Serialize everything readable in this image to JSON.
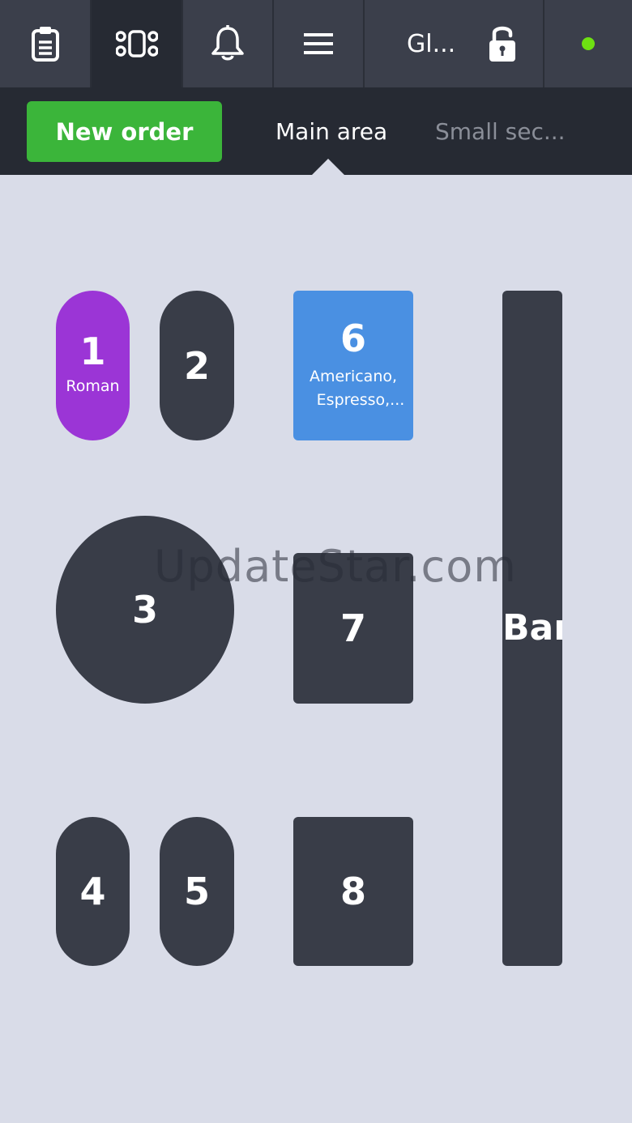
{
  "toolbar": {
    "items": [
      {
        "name": "orders",
        "icon": "clipboard-icon"
      },
      {
        "name": "tables",
        "icon": "table-layout-icon",
        "active": true
      },
      {
        "name": "notifications",
        "icon": "bell-icon"
      },
      {
        "name": "menu",
        "icon": "hamburger-icon"
      }
    ],
    "user_name": "Gl...",
    "lock_icon": "unlocked-padlock-icon",
    "status_color": "#6ee012"
  },
  "secondary_bar": {
    "new_order_label": "New order",
    "tabs": [
      {
        "label": "Main area",
        "active": true
      },
      {
        "label": "Small sec...",
        "active": false
      }
    ]
  },
  "tables": [
    {
      "number": "1",
      "subtitle": "Roman",
      "color": "#9b35d6"
    },
    {
      "number": "2"
    },
    {
      "number": "6",
      "subtitle_lines": [
        "Americano,",
        "Espresso,..."
      ],
      "color": "#4a90e2"
    },
    {
      "number": "3"
    },
    {
      "number": "7"
    },
    {
      "number": "4"
    },
    {
      "number": "5"
    },
    {
      "number": "8"
    },
    {
      "number": "Bar"
    }
  ],
  "watermark": "UpdateStar.com"
}
